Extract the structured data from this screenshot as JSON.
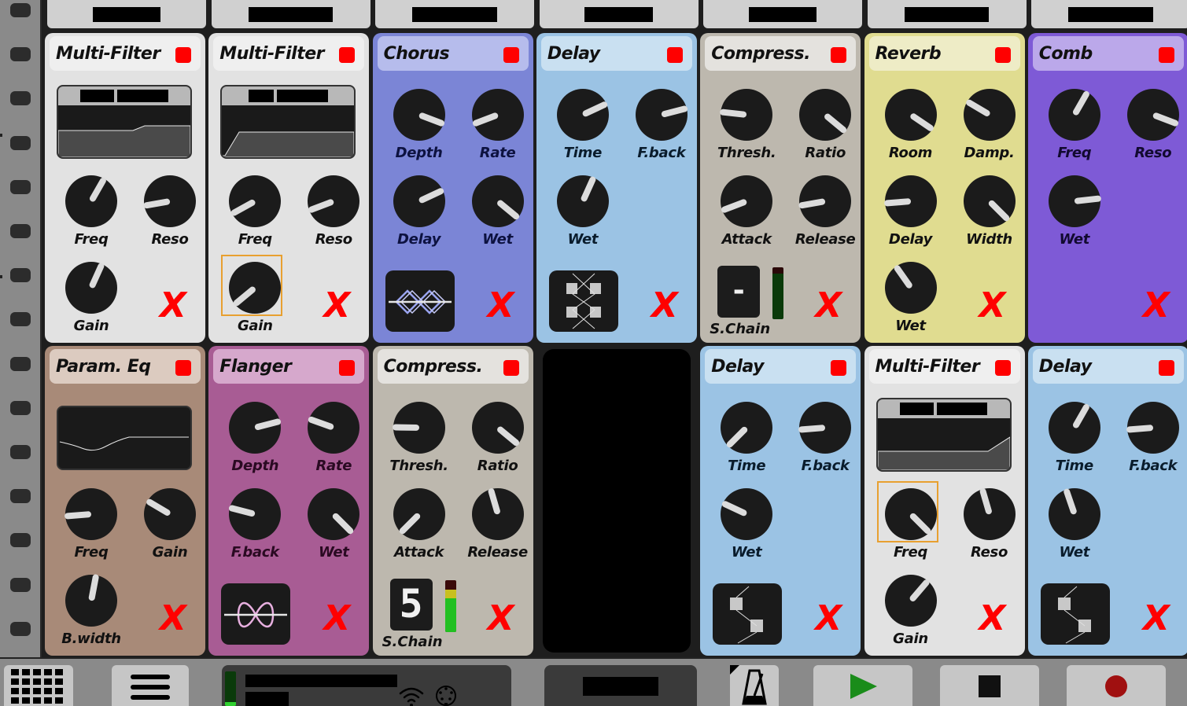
{
  "sidebar": {
    "slot_count": 15,
    "slots_label": "track-slot"
  },
  "top_tabs": [
    {
      "label": "████████"
    },
    {
      "label": "██████████"
    },
    {
      "label": "██████████"
    },
    {
      "label": "████████"
    },
    {
      "label": "████████"
    },
    {
      "label": "██████████"
    },
    {
      "label": "██████████"
    }
  ],
  "modules": [
    {
      "title": "Multi-Filter",
      "type": "multi-filter",
      "row": 0,
      "col": 0,
      "colors": {
        "body": "#e2e2e2",
        "header": "#efefef",
        "label": "#111111"
      },
      "power": "on",
      "screen": {
        "label_redacted": [
          "████",
          "██████"
        ],
        "curve": "highshelf"
      },
      "knobs": [
        {
          "label": "Freq",
          "value": 0.61
        },
        {
          "label": "Reso",
          "value": 0.13
        },
        {
          "label": "Gain",
          "value": 0.59
        }
      ],
      "close_label": "X"
    },
    {
      "title": "Multi-Filter",
      "type": "multi-filter",
      "row": 0,
      "col": 1,
      "colors": {
        "body": "#e2e2e2",
        "header": "#efefef",
        "label": "#111111"
      },
      "power": "on",
      "screen": {
        "label_redacted": [
          "███",
          "██████"
        ],
        "curve": "highpass"
      },
      "knobs": [
        {
          "label": "Freq",
          "value": 0.06
        },
        {
          "label": "Reso",
          "value": 0.09
        },
        {
          "label": "Gain",
          "value": 0.02,
          "selected": true
        }
      ],
      "close_label": "X"
    },
    {
      "title": "Chorus",
      "type": "chorus",
      "row": 0,
      "col": 2,
      "colors": {
        "body": "#7b85d6",
        "header": "#b6bcec",
        "label": "#0d1240"
      },
      "power": "on",
      "knobs": [
        {
          "label": "Depth",
          "value": 0.91
        },
        {
          "label": "Rate",
          "value": 0.09
        },
        {
          "label": "Delay",
          "value": 0.74
        },
        {
          "label": "Wet",
          "value": 0.98
        }
      ],
      "mode_icon": "chorus-wave-icon",
      "close_label": "X"
    },
    {
      "title": "Delay",
      "type": "delay",
      "row": 0,
      "col": 3,
      "colors": {
        "body": "#9bc3e4",
        "header": "#c9e0f1",
        "label": "#0a1c2c"
      },
      "power": "on",
      "knobs": [
        {
          "label": "Time",
          "value": 0.74
        },
        {
          "label": "F.back",
          "value": 0.78
        },
        {
          "label": "Wet",
          "value": 0.59
        }
      ],
      "mode_icon": "pingpong-delay-icon",
      "close_label": "X"
    },
    {
      "title": "Compress.",
      "type": "compressor",
      "row": 0,
      "col": 4,
      "colors": {
        "body": "#bdb8ae",
        "header": "#e4e2de",
        "label": "#111111"
      },
      "power": "on",
      "knobs": [
        {
          "label": "Thresh.",
          "value": 0.19
        },
        {
          "label": "Ratio",
          "value": 0.98
        },
        {
          "label": "Attack",
          "value": 0.09
        },
        {
          "label": "Release",
          "value": 0.13
        }
      ],
      "sidechain": {
        "display": "-",
        "label": "S.Chain",
        "meter_level": 0.0,
        "meter_active": false
      },
      "close_label": "X"
    },
    {
      "title": "Reverb",
      "type": "reverb",
      "row": 0,
      "col": 5,
      "colors": {
        "body": "#e0dc90",
        "header": "#eeecc6",
        "label": "#111111"
      },
      "power": "on",
      "knobs": [
        {
          "label": "Room",
          "value": 0.96
        },
        {
          "label": "Damp.",
          "value": 0.28
        },
        {
          "label": "Delay",
          "value": 0.15
        },
        {
          "label": "Width",
          "value": 1.0
        },
        {
          "label": "Wet",
          "value": 0.37
        }
      ],
      "close_label": "X"
    },
    {
      "title": "Comb",
      "type": "comb",
      "row": 0,
      "col": 6,
      "colors": {
        "body": "#7e5ad6",
        "header": "#bba8ea",
        "label": "#120a30"
      },
      "power": "on",
      "knobs": [
        {
          "label": "Freq",
          "value": 0.61
        },
        {
          "label": "Reso",
          "value": 0.91
        },
        {
          "label": "Wet",
          "value": 0.81
        }
      ],
      "close_label": "X"
    },
    {
      "title": "Param. Eq",
      "type": "param-eq",
      "row": 1,
      "col": 0,
      "colors": {
        "body": "#a88a78",
        "header": "#dccbc0",
        "label": "#111111"
      },
      "power": "on",
      "screen": {
        "curve": "dip"
      },
      "knobs": [
        {
          "label": "Freq",
          "value": 0.15
        },
        {
          "label": "Gain",
          "value": 0.28
        },
        {
          "label": "B.width",
          "value": 0.54
        }
      ],
      "close_label": "X"
    },
    {
      "title": "Flanger",
      "type": "flanger",
      "row": 1,
      "col": 1,
      "colors": {
        "body": "#a85c94",
        "header": "#d6a8cc",
        "label": "#2a0a22"
      },
      "power": "on",
      "knobs": [
        {
          "label": "Depth",
          "value": 0.78
        },
        {
          "label": "Rate",
          "value": 0.24
        },
        {
          "label": "F.back",
          "value": 0.22
        },
        {
          "label": "Wet",
          "value": 1.0
        }
      ],
      "mode_icon": "flanger-wave-icon",
      "close_label": "X"
    },
    {
      "title": "Compress.",
      "type": "compressor",
      "row": 1,
      "col": 2,
      "colors": {
        "body": "#bdb8ae",
        "header": "#e4e2de",
        "label": "#111111"
      },
      "power": "on",
      "knobs": [
        {
          "label": "Thresh.",
          "value": 0.17
        },
        {
          "label": "Ratio",
          "value": 0.98
        },
        {
          "label": "Attack",
          "value": 0.0
        },
        {
          "label": "Release",
          "value": 0.44
        }
      ],
      "sidechain": {
        "display": "5",
        "label": "S.Chain",
        "meter_level": 0.82,
        "meter_active": true
      },
      "close_label": "X"
    },
    {
      "title": "",
      "type": "empty",
      "row": 1,
      "col": 3
    },
    {
      "title": "Delay",
      "type": "delay",
      "row": 1,
      "col": 4,
      "colors": {
        "body": "#9bc3e4",
        "header": "#c9e0f1",
        "label": "#0a1c2c"
      },
      "power": "on",
      "knobs": [
        {
          "label": "Time",
          "value": 0.0
        },
        {
          "label": "F.back",
          "value": 0.15
        },
        {
          "label": "Wet",
          "value": 0.26
        }
      ],
      "mode_icon": "mono-delay-icon",
      "close_label": "X"
    },
    {
      "title": "Multi-Filter",
      "type": "multi-filter",
      "row": 1,
      "col": 5,
      "colors": {
        "body": "#e2e2e2",
        "header": "#efefef",
        "label": "#111111"
      },
      "power": "on",
      "screen": {
        "label_redacted": [
          "████",
          "██████"
        ],
        "curve": "bandshelf"
      },
      "knobs": [
        {
          "label": "Freq",
          "value": 1.0,
          "selected": true
        },
        {
          "label": "Reso",
          "value": 0.44
        },
        {
          "label": "Gain",
          "value": 0.65
        }
      ],
      "close_label": "X"
    },
    {
      "title": "Delay",
      "type": "delay",
      "row": 1,
      "col": 6,
      "colors": {
        "body": "#9bc3e4",
        "header": "#c9e0f1",
        "label": "#0a1c2c"
      },
      "power": "on",
      "knobs": [
        {
          "label": "Time",
          "value": 0.61
        },
        {
          "label": "F.back",
          "value": 0.15
        },
        {
          "label": "Wet",
          "value": 0.43
        }
      ],
      "mode_icon": "mono-delay-icon",
      "close_label": "X"
    }
  ],
  "bottom_bar": {
    "grid_button_icon": "grid-icon",
    "menu_button_icon": "hamburger-menu-icon",
    "status": {
      "line1_redacted": "██████████ ██ ████████",
      "line2_redacted": "███ █",
      "meter_level": 0.12,
      "wifi_icon": "wifi-icon",
      "midi_icon": "midi-icon"
    },
    "center_button_redacted": "███████",
    "metronome_icon": "metronome-icon",
    "transport": {
      "play_icon": "play-icon",
      "stop_icon": "stop-icon",
      "record_icon": "record-icon"
    },
    "colors": {
      "play": "#1a8c1a",
      "stop": "#111111",
      "record": "#a01010"
    }
  }
}
